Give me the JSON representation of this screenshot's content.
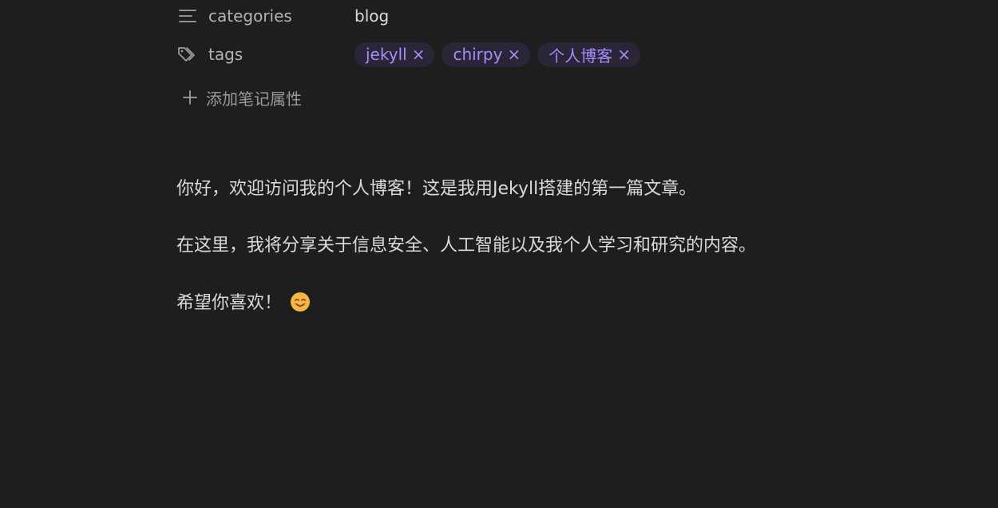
{
  "properties": {
    "categories": {
      "key": "categories",
      "icon": "list-icon",
      "value": "blog"
    },
    "tags": {
      "key": "tags",
      "icon": "tags-icon",
      "items": [
        {
          "label": "jekyll",
          "remove": "×"
        },
        {
          "label": "chirpy",
          "remove": "×"
        },
        {
          "label": "个人博客",
          "remove": "×"
        }
      ]
    },
    "add_label": "添加笔记属性"
  },
  "content": {
    "paragraphs": [
      "你好，欢迎访问我的个人博客！这是我用Jekyll搭建的第一篇文章。",
      "在这里，我将分享关于信息安全、人工智能以及我个人学习和研究的内容。",
      "希望你喜欢！"
    ],
    "emoji": "smiling-face-emoji"
  },
  "colors": {
    "background": "#1e1e1e",
    "text": "#dadada",
    "muted": "#b3b3b3",
    "tag_bg": "#2b2538",
    "tag_text": "#a88bfa"
  }
}
